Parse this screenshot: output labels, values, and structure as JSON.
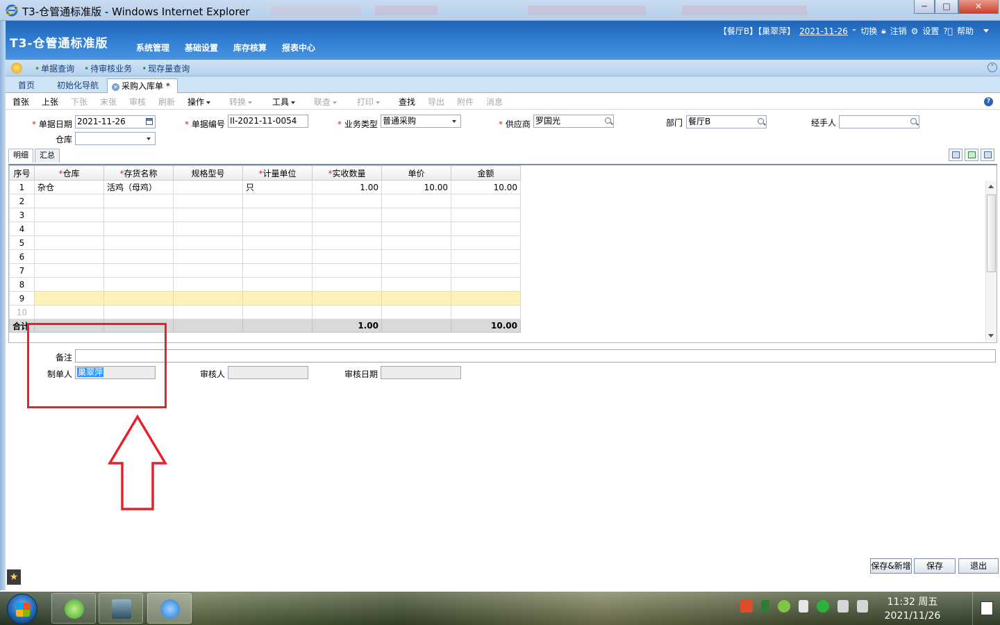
{
  "window": {
    "title": "T3-仓管通标准版 - Windows Internet Explorer",
    "controls": [
      "─",
      "□",
      "✕"
    ]
  },
  "app": {
    "logo": "T3-仓管通标准版",
    "menu": [
      "系统管理",
      "基础设置",
      "库存核算",
      "报表中心"
    ],
    "userinfo": {
      "context": "【餐厅B】【巢翠萍】",
      "date": "2021-11-26",
      "switch": "切换",
      "logout": "注销",
      "settings": "设置",
      "help": "帮助"
    }
  },
  "quicklinks": [
    "单据查询",
    "待审核业务",
    "现存量查询"
  ],
  "tabs": [
    {
      "label": "首页"
    },
    {
      "label": "初始化导航"
    },
    {
      "label": "采购入库单 *"
    }
  ],
  "toolbar": {
    "first": "首张",
    "prev": "上张",
    "next": "下张",
    "last": "末张",
    "audit": "审核",
    "refresh": "刷新",
    "operate": "操作",
    "convert": "转换",
    "tools": "工具",
    "linkquery": "联查",
    "print": "打印",
    "find": "查找",
    "export": "导出",
    "attach": "附件",
    "message": "消息"
  },
  "form": {
    "req_mark": "*",
    "date_label": "单据日期",
    "date_value": "2021-11-26",
    "docno_label": "单据编号",
    "docno_value": "II-2021-11-0054",
    "biztype_label": "业务类型",
    "biztype_value": "普通采购",
    "supplier_label": "供应商",
    "supplier_value": "罗国光",
    "dept_label": "部门",
    "dept_value": "餐厅B",
    "handler_label": "经手人",
    "handler_value": "",
    "warehouse_label": "仓库",
    "warehouse_value": ""
  },
  "subtabs": [
    "明细",
    "汇总"
  ],
  "grid": {
    "columns": [
      "序号",
      "*仓库",
      "*存货名称",
      "规格型号",
      "*计量单位",
      "*实收数量",
      "单价",
      "金额"
    ],
    "rows": [
      [
        "1",
        "杂仓",
        "活鸡（母鸡）",
        "",
        "只",
        "1.00",
        "10.00",
        "10.00"
      ],
      [
        "2",
        "",
        "",
        "",
        "",
        "",
        "",
        ""
      ],
      [
        "3",
        "",
        "",
        "",
        "",
        "",
        "",
        ""
      ],
      [
        "4",
        "",
        "",
        "",
        "",
        "",
        "",
        ""
      ],
      [
        "5",
        "",
        "",
        "",
        "",
        "",
        "",
        ""
      ],
      [
        "6",
        "",
        "",
        "",
        "",
        "",
        "",
        ""
      ],
      [
        "7",
        "",
        "",
        "",
        "",
        "",
        "",
        ""
      ],
      [
        "8",
        "",
        "",
        "",
        "",
        "",
        "",
        ""
      ],
      [
        "9",
        "",
        "",
        "",
        "",
        "",
        "",
        ""
      ],
      [
        "10",
        "",
        "",
        "",
        "",
        "",
        "",
        ""
      ]
    ],
    "selected_row": 9,
    "total": {
      "label": "合计",
      "qty": "1.00",
      "amount": "10.00"
    }
  },
  "footer": {
    "remarks_label": "备注",
    "remarks_value": "",
    "maker_label": "制单人",
    "maker_value": "巢翠萍",
    "auditor_label": "审核人",
    "auditor_value": "",
    "auditdate_label": "审核日期",
    "auditdate_value": ""
  },
  "buttons": {
    "save_new": "保存&新增",
    "save": "保存",
    "exit": "退出"
  },
  "taskbar": {
    "time": "11:32 周五",
    "date": "2021/11/26"
  },
  "colors": {
    "header_blue": "#2e7cd1",
    "selected_row": "#fdf3b8",
    "annotation_red": "#e4222a",
    "required_red": "#e02020"
  }
}
